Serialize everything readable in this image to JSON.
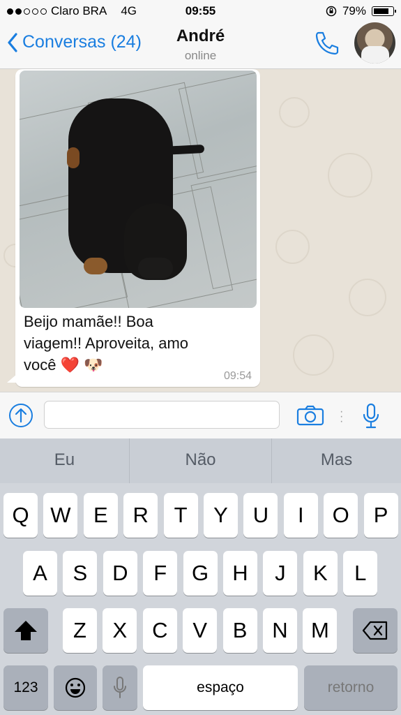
{
  "status_bar": {
    "carrier": "Claro BRA",
    "network": "4G",
    "time": "09:55",
    "battery": "79%",
    "battery_level": 0.79,
    "signal_bars_filled": 2,
    "signal_bars_total": 5
  },
  "nav": {
    "back_label": "Conversas (24)",
    "contact_name": "André",
    "contact_status": "online"
  },
  "message": {
    "text_lines": [
      "Beijo mamãe!!  Boa",
      "viagem!!  Aproveita,  amo",
      "você ❤️ 🐶"
    ],
    "time": "09:54"
  },
  "composer": {
    "value": "",
    "placeholder": ""
  },
  "suggestions": [
    "Eu",
    "Não",
    "Mas"
  ],
  "keyboard": {
    "row1": [
      "Q",
      "W",
      "E",
      "R",
      "T",
      "Y",
      "U",
      "I",
      "O",
      "P"
    ],
    "row2": [
      "A",
      "S",
      "D",
      "F",
      "G",
      "H",
      "J",
      "K",
      "L"
    ],
    "row3": [
      "Z",
      "X",
      "C",
      "V",
      "B",
      "N",
      "M"
    ],
    "numbers_label": "123",
    "space_label": "espaço",
    "return_label": "retorno"
  },
  "colors": {
    "accent": "#1a7ee0",
    "chat_background": "#e8e2d8",
    "keyboard_background": "#d1d5db"
  },
  "icons": [
    "back-chevron-icon",
    "call-icon",
    "upload-icon",
    "camera-icon",
    "more-icon",
    "microphone-icon",
    "shift-icon",
    "backspace-icon",
    "emoji-icon",
    "dictation-icon"
  ]
}
